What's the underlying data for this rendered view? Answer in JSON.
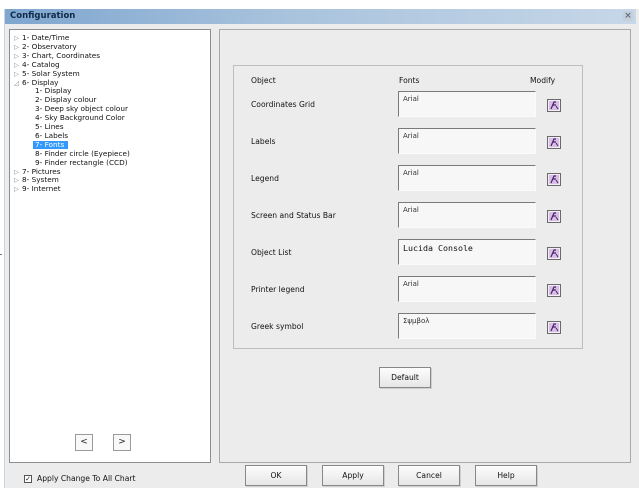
{
  "window": {
    "title": "Configuration",
    "close_glyph": "×"
  },
  "tree": {
    "items": [
      {
        "label": "1- Date/Time",
        "expander": "▷",
        "level": 0
      },
      {
        "label": "2- Observatory",
        "expander": "▷",
        "level": 0
      },
      {
        "label": "3- Chart, Coordinates",
        "expander": "▷",
        "level": 0
      },
      {
        "label": "4- Catalog",
        "expander": "▷",
        "level": 0
      },
      {
        "label": "5- Solar System",
        "expander": "▷",
        "level": 0
      },
      {
        "label": "6- Display",
        "expander": "◿",
        "level": 0
      },
      {
        "label": "1- Display",
        "expander": "",
        "level": 1
      },
      {
        "label": "2- Display colour",
        "expander": "",
        "level": 1
      },
      {
        "label": "3- Deep sky object colour",
        "expander": "",
        "level": 1
      },
      {
        "label": "4- Sky Background Color",
        "expander": "",
        "level": 1
      },
      {
        "label": "5- Lines",
        "expander": "",
        "level": 1
      },
      {
        "label": "6- Labels",
        "expander": "",
        "level": 1
      },
      {
        "label": "7- Fonts",
        "expander": "",
        "level": 1,
        "selected": true
      },
      {
        "label": "8- Finder circle (Eyepiece)",
        "expander": "",
        "level": 1
      },
      {
        "label": "9- Finder rectangle (CCD)",
        "expander": "",
        "level": 1
      },
      {
        "label": "7- Pictures",
        "expander": "▷",
        "level": 0
      },
      {
        "label": "8- System",
        "expander": "▷",
        "level": 0
      },
      {
        "label": "9- Internet",
        "expander": "▷",
        "level": 0
      }
    ],
    "prev_label": "<",
    "next_label": ">"
  },
  "fonts": {
    "headers": {
      "object": "Object",
      "fonts": "Fonts",
      "modify": "Modify"
    },
    "rows": [
      {
        "object": "Coordinates Grid",
        "font": "Arial"
      },
      {
        "object": "Labels",
        "font": "Arial"
      },
      {
        "object": "Legend",
        "font": "Arial"
      },
      {
        "object": "Screen and Status Bar",
        "font": "Arial"
      },
      {
        "object": "Object List",
        "font": "Lucida Console"
      },
      {
        "object": "Printer legend",
        "font": "Arial"
      },
      {
        "object": "Greek symbol",
        "font": "Σψμβολ"
      }
    ],
    "modify_icon": "font-edit-icon",
    "default_label": "Default"
  },
  "footer": {
    "apply_all_checked": true,
    "apply_all_label": "Apply Change To All Chart",
    "ok_label": "OK",
    "apply_label": "Apply",
    "cancel_label": "Cancel",
    "help_label": "Help"
  }
}
